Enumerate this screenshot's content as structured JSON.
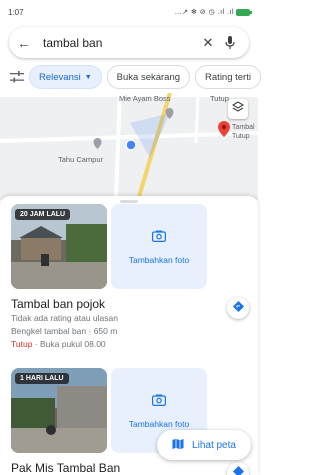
{
  "status_bar": {
    "time": "1:07",
    "icons_text": "...↗ ✻ ⊘ ◷ .ıl .ıl"
  },
  "search": {
    "query": "tambal ban",
    "back_icon": "arrow-back-icon",
    "clear_icon": "close-icon",
    "mic_icon": "mic-icon"
  },
  "filters": {
    "icon": "tune-icon",
    "chips": [
      {
        "label": "Relevansi",
        "active": true
      },
      {
        "label": "Buka sekarang",
        "active": false
      },
      {
        "label": "Rating terti",
        "active": false
      }
    ]
  },
  "map": {
    "labels": {
      "mie_ayam": "Mie Ayam Boss",
      "tutup_top": "Tutup",
      "pin_name": "Tambal",
      "pin_status": "Tutup",
      "tahu": "Tahu Campur"
    }
  },
  "results": [
    {
      "photo_badge": "20 JAM LALU",
      "add_photo_label": "Tambahkan foto",
      "name": "Tambal ban pojok",
      "rating_text": "Tidak ada rating atau ulasan",
      "category_distance": "Bengkel tambal ban · 650 m",
      "status": "Tutup",
      "opening": " · Buka pukul 08.00"
    },
    {
      "photo_badge": "1 HARI LALU",
      "add_photo_label": "Tambahkan foto",
      "name": "Pak Mis Tambal Ban"
    }
  ],
  "view_map_label": "Lihat peta",
  "colors": {
    "accent": "#1a73e8",
    "closed": "#d93025",
    "chip_active_bg": "#e8f0fe",
    "road": "#f6d36b",
    "pin": "#ea4335"
  }
}
